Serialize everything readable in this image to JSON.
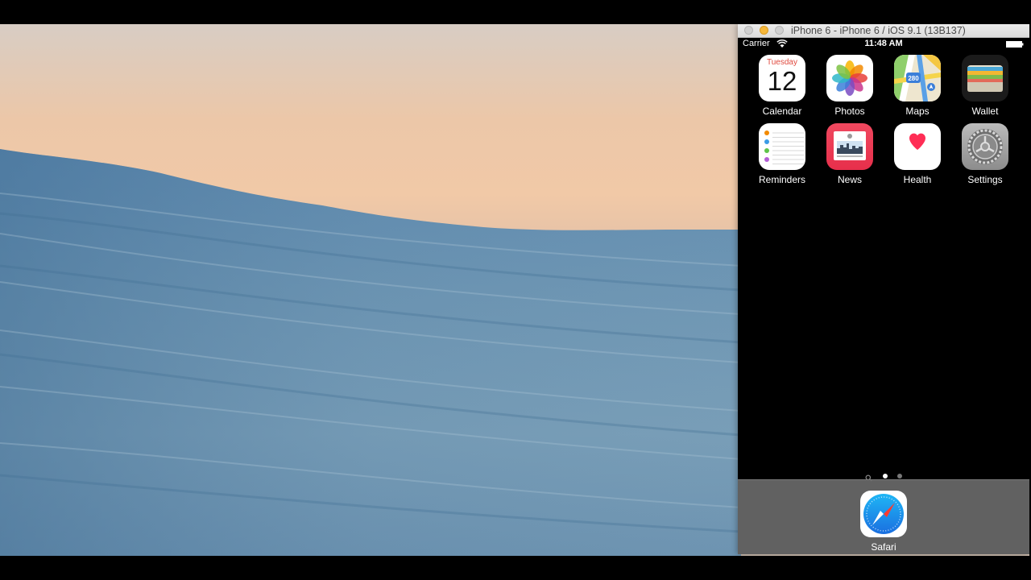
{
  "window": {
    "title": "iPhone 6 - iPhone 6 / iOS 9.1 (13B137)"
  },
  "statusbar": {
    "carrier": "Carrier",
    "time": "11:48 AM",
    "wifi_icon": "wifi-icon",
    "battery_icon": "battery-full-icon"
  },
  "home": {
    "apps": [
      {
        "label": "Calendar",
        "icon": "calendar-icon"
      },
      {
        "label": "Photos",
        "icon": "photos-icon"
      },
      {
        "label": "Maps",
        "icon": "maps-icon"
      },
      {
        "label": "Wallet",
        "icon": "wallet-icon"
      },
      {
        "label": "Reminders",
        "icon": "reminders-icon"
      },
      {
        "label": "News",
        "icon": "news-icon"
      },
      {
        "label": "Health",
        "icon": "health-icon"
      },
      {
        "label": "Settings",
        "icon": "settings-icon"
      }
    ],
    "calendar": {
      "weekday": "Tuesday",
      "date": "12"
    },
    "maps": {
      "route_number": "280"
    },
    "page_indicator": {
      "pages": 2,
      "current": 1
    }
  },
  "dock": {
    "apps": [
      {
        "label": "Safari",
        "icon": "safari-icon"
      }
    ]
  },
  "colors": {
    "accent_red": "#e04a3f",
    "news_red": "#e72f4b",
    "health_heart": "#ff2d55",
    "dock_bg": "#696969"
  }
}
